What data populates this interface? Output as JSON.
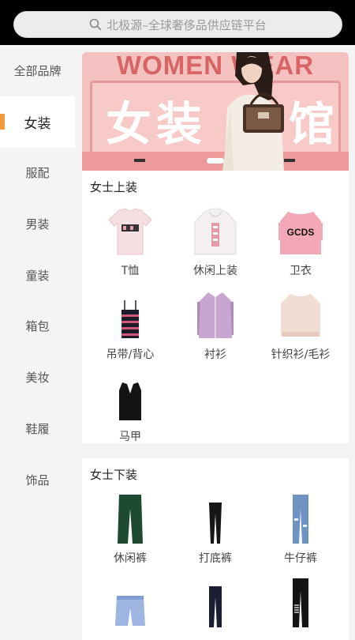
{
  "search": {
    "placeholder": "北极源–全球奢侈品供应链平台"
  },
  "sidebar": {
    "items": [
      {
        "label": "全部品牌"
      },
      {
        "label": "女装"
      },
      {
        "label": "服配"
      },
      {
        "label": "男装"
      },
      {
        "label": "童装"
      },
      {
        "label": "箱包"
      },
      {
        "label": "美妆"
      },
      {
        "label": "鞋履"
      },
      {
        "label": "饰品"
      }
    ],
    "active_index": 1
  },
  "banner": {
    "title_en": "WOMEN   WEAR",
    "title_zh_left": "女装",
    "title_zh_right": "馆"
  },
  "sections": [
    {
      "title": "女士上装",
      "items": [
        {
          "label": "T恤",
          "icon": "tshirt-icon"
        },
        {
          "label": "休闲上装",
          "icon": "hoodie-icon"
        },
        {
          "label": "卫衣",
          "icon": "sweatshirt-icon"
        },
        {
          "label": "吊带/背心",
          "icon": "camisole-icon"
        },
        {
          "label": "衬衫",
          "icon": "shirt-icon"
        },
        {
          "label": "针织衫/毛衫",
          "icon": "knit-sweater-icon"
        },
        {
          "label": "马甲",
          "icon": "vest-icon"
        }
      ]
    },
    {
      "title": "女士下装",
      "items": [
        {
          "label": "休闲裤",
          "icon": "casual-pants-icon"
        },
        {
          "label": "打底裤",
          "icon": "leggings-icon"
        },
        {
          "label": "牛仔裤",
          "icon": "jeans-icon"
        },
        {
          "label": "",
          "icon": "shorts-icon"
        },
        {
          "label": "",
          "icon": "trousers-icon"
        },
        {
          "label": "",
          "icon": "track-pants-icon"
        }
      ]
    }
  ],
  "product_details": {
    "sweatshirt_print": "GCDS"
  },
  "colors": {
    "accent": "#f39a3b",
    "banner_pink": "#f3c1bf",
    "banner_text": "#d86466"
  }
}
